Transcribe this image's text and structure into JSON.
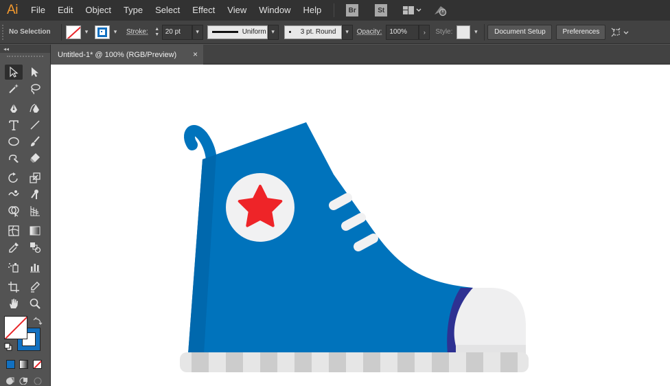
{
  "app": {
    "logo": "Ai",
    "menu": [
      "File",
      "Edit",
      "Object",
      "Type",
      "Select",
      "Effect",
      "View",
      "Window",
      "Help"
    ],
    "badges": [
      "Br",
      "St"
    ],
    "icons": [
      "workspace-layout-icon",
      "gpu-performance-icon"
    ]
  },
  "control_bar": {
    "selection": "No Selection",
    "stroke_label": "Stroke:",
    "stroke_weight": "20 pt",
    "profile": "Uniform",
    "brush": "3 pt. Round",
    "opacity_label": "Opacity:",
    "opacity_value": "100%",
    "style_label": "Style:",
    "document_setup": "Document Setup",
    "preferences": "Preferences"
  },
  "document": {
    "tab_title": "Untitled-1* @ 100% (RGB/Preview)",
    "close_glyph": "×"
  },
  "toolbox": {
    "collapse_glyph": "◂◂",
    "tools": [
      "selection-tool-icon",
      "direct-selection-tool-icon",
      "magic-wand-tool-icon",
      "lasso-tool-icon",
      "pen-tool-icon",
      "curvature-tool-icon",
      "type-tool-icon",
      "line-segment-tool-icon",
      "ellipse-tool-icon",
      "paintbrush-tool-icon",
      "shaper-tool-icon",
      "eraser-tool-icon",
      "rotate-tool-icon",
      "scale-tool-icon",
      "warp-tool-icon",
      "puppet-warp-tool-icon",
      "shape-builder-tool-icon",
      "perspective-grid-tool-icon",
      "mesh-tool-icon",
      "gradient-tool-icon",
      "eyedropper-tool-icon",
      "blend-tool-icon",
      "symbol-sprayer-tool-icon",
      "column-graph-tool-icon",
      "artboard-tool-icon",
      "slice-tool-icon",
      "hand-tool-icon",
      "zoom-tool-icon"
    ]
  },
  "colors": {
    "shoe_blue": "#0073bc",
    "shoe_blue_dark": "#0068ad",
    "star_red": "#ee2428",
    "badge_white": "#f1f1f2",
    "toe_cap": "#efeff0",
    "toe_stripe": "#2e3192",
    "sole_light": "#e6e6e6",
    "sole_dark": "#cccccc",
    "lace": "#f1f1f2",
    "stroke_swatch": "#1270c0",
    "fill_none_slash": "#e8262a"
  }
}
